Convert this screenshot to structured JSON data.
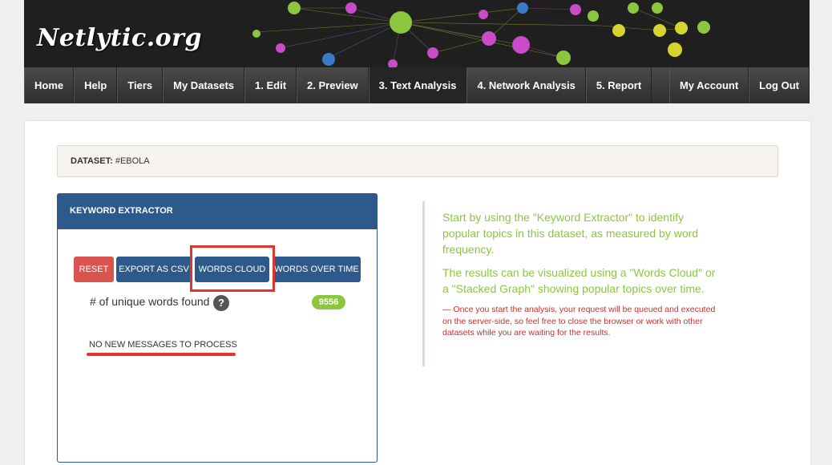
{
  "header": {
    "logo": "Netlytic.org"
  },
  "nav": {
    "left_items": [
      {
        "label": "Home"
      },
      {
        "label": "Help"
      },
      {
        "label": "Tiers"
      },
      {
        "label": "My Datasets"
      },
      {
        "label": "1. Edit"
      },
      {
        "label": "2. Preview"
      },
      {
        "label": "3. Text Analysis",
        "active": true
      },
      {
        "label": "4. Network Analysis"
      },
      {
        "label": "5. Report"
      }
    ],
    "right_items": [
      {
        "label": "My Account"
      },
      {
        "label": "Log Out"
      }
    ]
  },
  "dataset": {
    "label": "DATASET:",
    "value": "#EBOLA"
  },
  "extractor": {
    "title": "KEYWORD EXTRACTOR",
    "buttons": {
      "reset": "Reset",
      "export": "Export as CSV",
      "words_cloud": "Words Cloud",
      "words_over_time": "Words over time"
    },
    "unique_label": "# of unique words found",
    "unique_count": "9556",
    "status": "NO NEW MESSAGES TO PROCESS"
  },
  "info": {
    "para1": "Start by using the \"Keyword Extractor\" to identify popular topics in this dataset, as measured by word frequency.",
    "para2": "The results can be visualized using a \"Words Cloud\" or a \"Stacked Graph\" showing popular topics over time.",
    "note": "— Once you start the analysis, your request will be queued and executed on the server-side, so feel free to close the browser or work with other datasets while you are waiting for the results."
  },
  "colors": {
    "primary_blue": "#2d5a8a",
    "reset_red": "#d9534f",
    "accent_green": "#8cc63f",
    "annotation_red": "#e0342c"
  }
}
